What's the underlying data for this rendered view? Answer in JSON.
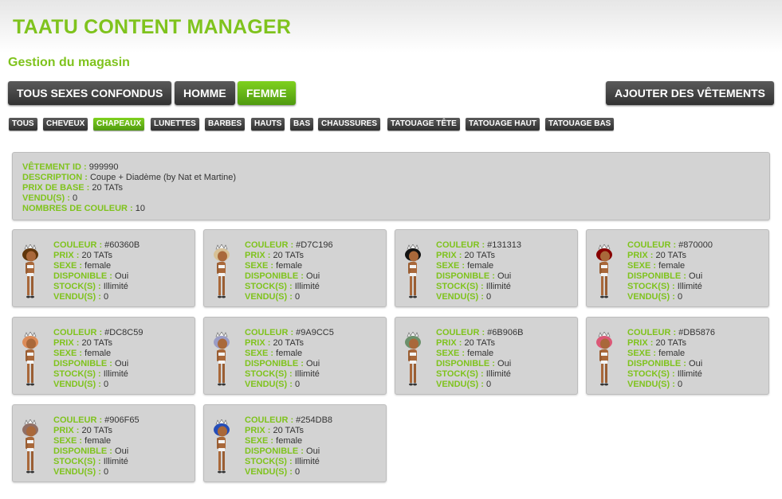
{
  "header": {
    "title": "TAATU CONTENT MANAGER",
    "subtitle": "Gestion du magasin"
  },
  "gender_filters": [
    {
      "label": "TOUS SEXES CONFONDUS",
      "active": false
    },
    {
      "label": "HOMME",
      "active": false
    },
    {
      "label": "FEMME",
      "active": true
    }
  ],
  "add_button": {
    "label": "AJOUTER DES VÊTEMENTS"
  },
  "categories": [
    {
      "label": "TOUS",
      "active": false
    },
    {
      "label": "CHEVEUX",
      "active": false
    },
    {
      "label": "CHAPEAUX",
      "active": true
    },
    {
      "label": "LUNETTES",
      "active": false
    },
    {
      "label": "BARBES",
      "active": false
    },
    {
      "label": "HAUTS",
      "active": false
    },
    {
      "label": "BAS",
      "active": false
    },
    {
      "label": "CHAUSSURES",
      "active": false
    },
    {
      "label": "TATOUAGE TÊTE",
      "active": false
    },
    {
      "label": "TATOUAGE HAUT",
      "active": false
    },
    {
      "label": "TATOUAGE BAS",
      "active": false
    }
  ],
  "item": {
    "id_label": "VÊTEMENT ID :",
    "id": "999990",
    "description_label": "DESCRIPTION :",
    "description": "Coupe + Diadème (by Nat et Martine)",
    "price_label": "PRIX DE BASE :",
    "price": "20 TATs",
    "sold_label": "VENDU(S) :",
    "sold": "0",
    "colors_label": "NOMBRES DE COULEUR :",
    "colors": "10"
  },
  "variant_labels": {
    "color": "COULEUR :",
    "price": "PRIX :",
    "sex": "SEXE :",
    "available": "DISPONIBLE :",
    "stock": "STOCK(S) :",
    "sold": "VENDU(S) :"
  },
  "variants": [
    {
      "color": "#60360B",
      "price": "20 TATs",
      "sex": "female",
      "available": "Oui",
      "stock": "Illimité",
      "sold": "0"
    },
    {
      "color": "#D7C196",
      "price": "20 TATs",
      "sex": "female",
      "available": "Oui",
      "stock": "Illimité",
      "sold": "0"
    },
    {
      "color": "#131313",
      "price": "20 TATs",
      "sex": "female",
      "available": "Oui",
      "stock": "Illimité",
      "sold": "0"
    },
    {
      "color": "#870000",
      "price": "20 TATs",
      "sex": "female",
      "available": "Oui",
      "stock": "Illimité",
      "sold": "0"
    },
    {
      "color": "#DC8C59",
      "price": "20 TATs",
      "sex": "female",
      "available": "Oui",
      "stock": "Illimité",
      "sold": "0"
    },
    {
      "color": "#9A9CC5",
      "price": "20 TATs",
      "sex": "female",
      "available": "Oui",
      "stock": "Illimité",
      "sold": "0"
    },
    {
      "color": "#6B906B",
      "price": "20 TATs",
      "sex": "female",
      "available": "Oui",
      "stock": "Illimité",
      "sold": "0"
    },
    {
      "color": "#DB5876",
      "price": "20 TATs",
      "sex": "female",
      "available": "Oui",
      "stock": "Illimité",
      "sold": "0"
    },
    {
      "color": "#906F65",
      "price": "20 TATs",
      "sex": "female",
      "available": "Oui",
      "stock": "Illimité",
      "sold": "0"
    },
    {
      "color": "#254DB8",
      "price": "20 TATs",
      "sex": "female",
      "available": "Oui",
      "stock": "Illimité",
      "sold": "0"
    }
  ],
  "colors": {
    "accent": "#7fc31d",
    "button_dark": "#3c3c3c",
    "button_active": "#62b016",
    "panel": "#d3d3d3"
  }
}
